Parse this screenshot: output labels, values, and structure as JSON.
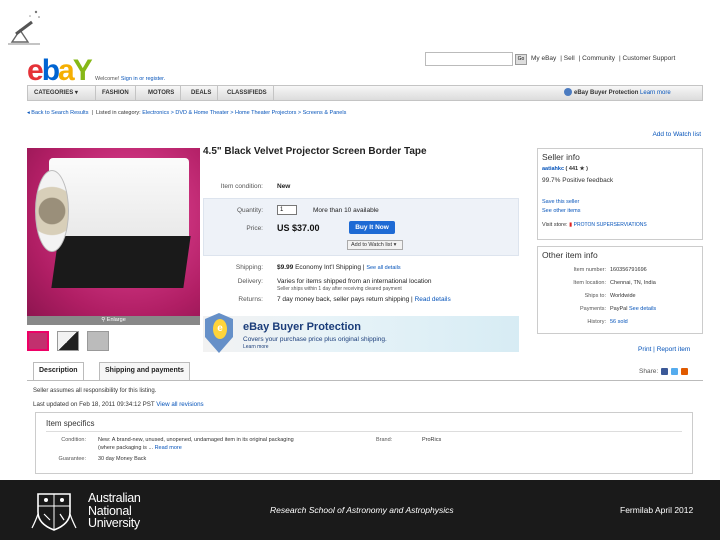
{
  "header": {
    "go_label": "Go",
    "links": [
      "My eBay",
      "Sell",
      "Community",
      "Customer Support"
    ],
    "welcome": "Welcome! ",
    "sign_in": "Sign in or register."
  },
  "nav": {
    "tabs": [
      "CATEGORIES",
      "FASHION",
      "MOTORS",
      "DEALS",
      "CLASSIFIEDS"
    ],
    "protection": "eBay Buyer Protection",
    "learn_more": "Learn more"
  },
  "breadcrumb": {
    "back": "Back to Search Results",
    "listed_in": "Listed in category:",
    "path": "Electronics > DVD & Home Theater > Home Theater Projectors > Screens & Panels"
  },
  "add_to_watch": "Add to Watch list",
  "item": {
    "title": "4.5\" Black Velvet Projector Screen Border Tape",
    "condition_label": "Item condition:",
    "condition": "New",
    "quantity_label": "Quantity:",
    "quantity": "1",
    "available": "More than 10 available",
    "price_label": "Price:",
    "price": "US $37.00",
    "buy_now": "Buy It Now",
    "add_to_watch": "Add to Watch list",
    "shipping_label": "Shipping:",
    "shipping_cost": "$9.99",
    "shipping_text": "Economy Int'l Shipping",
    "see_details": "See all details",
    "delivery_label": "Delivery:",
    "delivery": "Varies for items shipped from an international location",
    "delivery_note": "Seller ships within 1 day after receiving cleared payment",
    "returns_label": "Returns:",
    "returns": "7 day money back, seller pays return shipping",
    "read_details": "Read details",
    "enlarge": "Enlarge"
  },
  "protection_banner": {
    "heading": "eBay Buyer Protection",
    "sub": "Covers your purchase price plus original shipping.",
    "more": "Learn more"
  },
  "seller": {
    "heading": "Seller info",
    "name": "aatiahkc",
    "feedback_count": "( 441 ★ )",
    "positive": "99.7% Positive feedback",
    "save": "Save this seller",
    "other_items": "See other items",
    "visit_store": "Visit store:",
    "store_name": "PROTON SUPERSERVIATIONS"
  },
  "other_info": {
    "heading": "Other item info",
    "rows": [
      {
        "label": "Item number:",
        "value": "160356791696"
      },
      {
        "label": "Item location:",
        "value": "Chennai, TN, India"
      },
      {
        "label": "Ships to:",
        "value": "Worldwide"
      },
      {
        "label": "Payments:",
        "value": "PayPal"
      },
      {
        "label": "History:",
        "value": "56 sold"
      }
    ],
    "see_details": "See details"
  },
  "print_report": {
    "print": "Print",
    "report": "Report item"
  },
  "tabs": [
    "Description",
    "Shipping and payments"
  ],
  "share": "Share:",
  "seller_note": "Seller assumes all responsibility for this listing.",
  "updated": "Last updated on Feb 18, 2011 09:34:12 PST",
  "view_revisions": "View all revisions",
  "specifics": {
    "heading": "Item specifics",
    "condition_label": "Condition:",
    "condition": "New: A brand-new, unused, unopened, undamaged item in its original packaging",
    "condition_2": "(where packaging is ...",
    "read_more": "Read more",
    "brand_label": "Brand:",
    "brand": "ProRics",
    "guarantee_label": "Guarantee:",
    "guarantee": "30 day Money Back"
  },
  "footer": {
    "uni_line1": "Australian",
    "uni_line2": "National",
    "uni_line3": "University",
    "center": "Research School of Astronomy and Astrophysics",
    "right": "Fermilab April 2012"
  },
  "colors": {
    "ebay_red": "#e53238",
    "ebay_blue": "#0064d2",
    "ebay_yellow": "#f5af02",
    "ebay_green": "#86b817",
    "link": "#0654ba",
    "footer_bg": "#1a1a1a"
  }
}
